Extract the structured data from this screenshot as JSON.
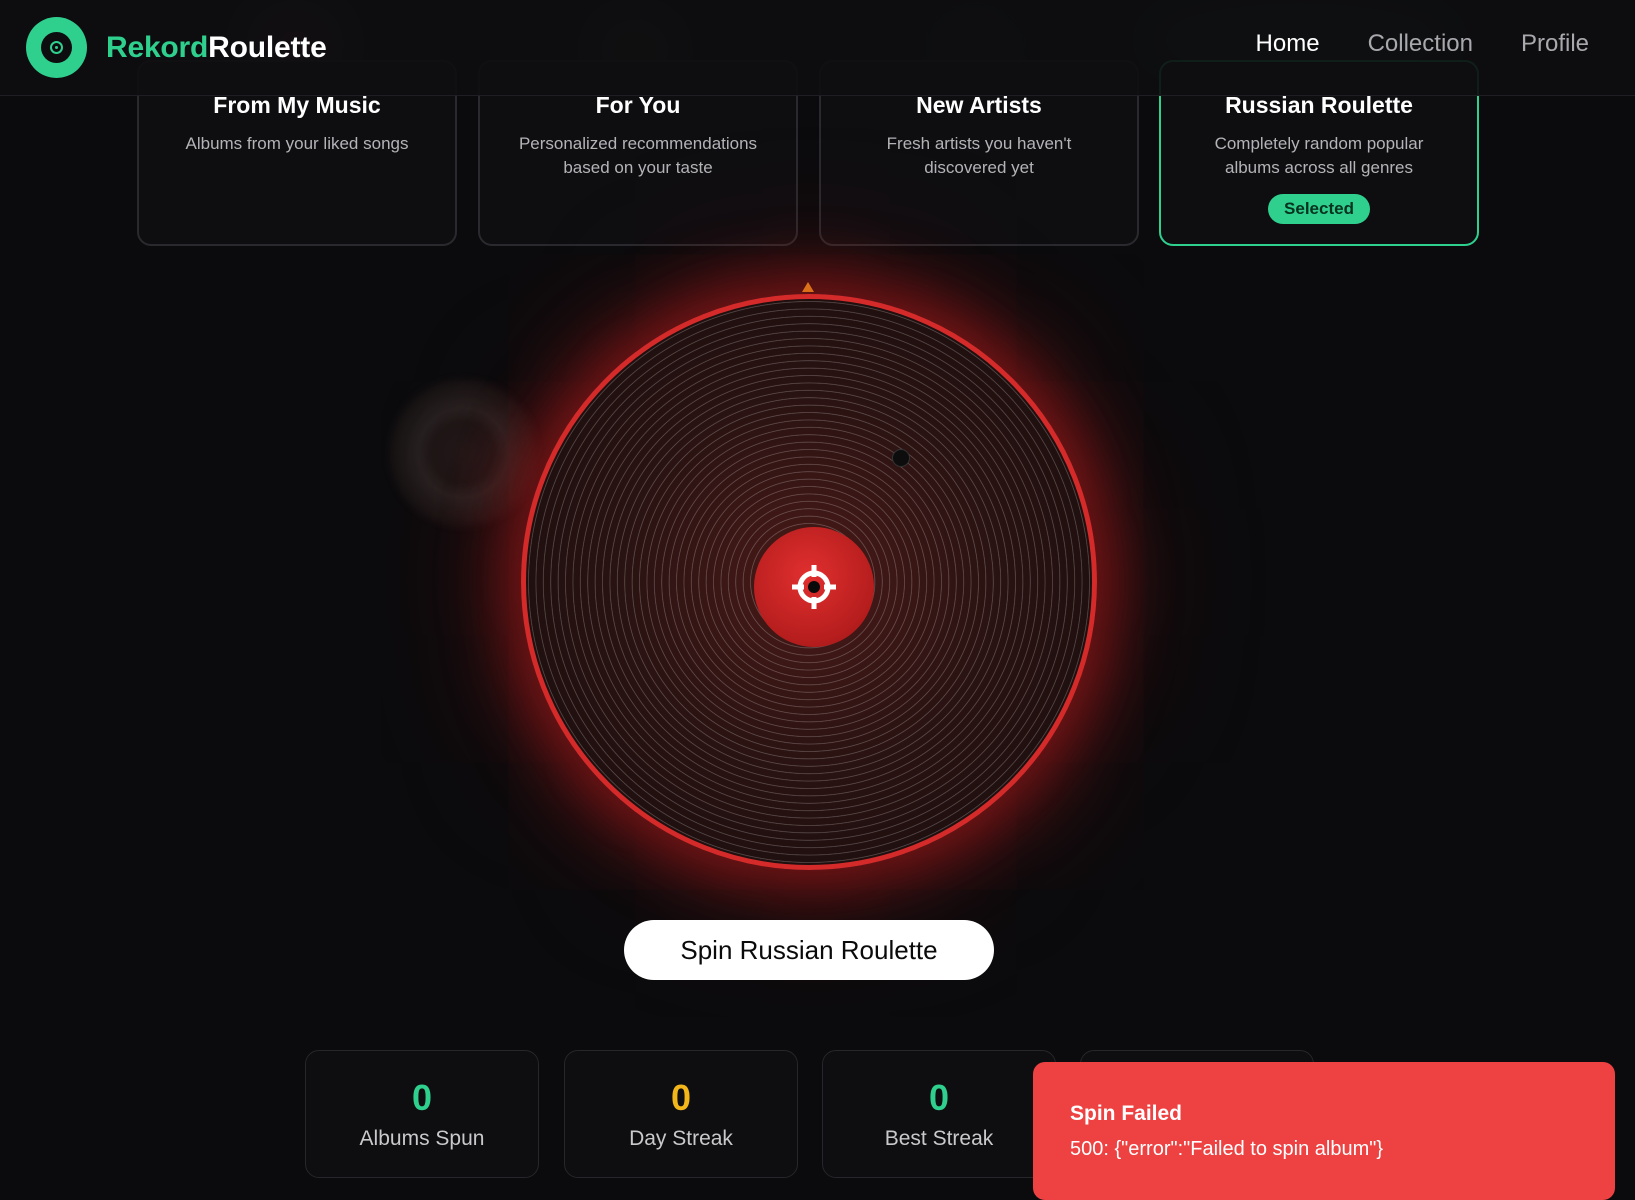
{
  "app": {
    "brand_part1": "Rekord",
    "brand_part2": "Roulette",
    "accent_color": "#2fd08e",
    "danger_color": "#ee4142"
  },
  "nav": {
    "items": [
      {
        "label": "Home",
        "active": true
      },
      {
        "label": "Collection",
        "active": false
      },
      {
        "label": "Profile",
        "active": false
      }
    ]
  },
  "modes": [
    {
      "title": "From My Music",
      "desc": "Albums from your liked songs",
      "selected": false
    },
    {
      "title": "For You",
      "desc": "Personalized recommendations based on your taste",
      "selected": false
    },
    {
      "title": "New Artists",
      "desc": "Fresh artists you haven't discovered yet",
      "selected": false
    },
    {
      "title": "Russian Roulette",
      "desc": "Completely random popular albums across all genres",
      "selected": true,
      "badge": "Selected"
    }
  ],
  "wheel": {
    "center_icon": "crosshair-icon",
    "pointer_icon": "pointer-triangle-icon",
    "ring_color": "#d42a2a"
  },
  "spin_button": {
    "label": "Spin Russian Roulette"
  },
  "stats": [
    {
      "value": "0",
      "label": "Albums Spun",
      "color": "#2fd08e"
    },
    {
      "value": "0",
      "label": "Day Streak",
      "color": "#f2b61a"
    },
    {
      "value": "0",
      "label": "Best Streak",
      "color": "#2fd08e"
    }
  ],
  "toast": {
    "title": "Spin Failed",
    "message": "500: {\"error\":\"Failed to spin album\"}"
  }
}
